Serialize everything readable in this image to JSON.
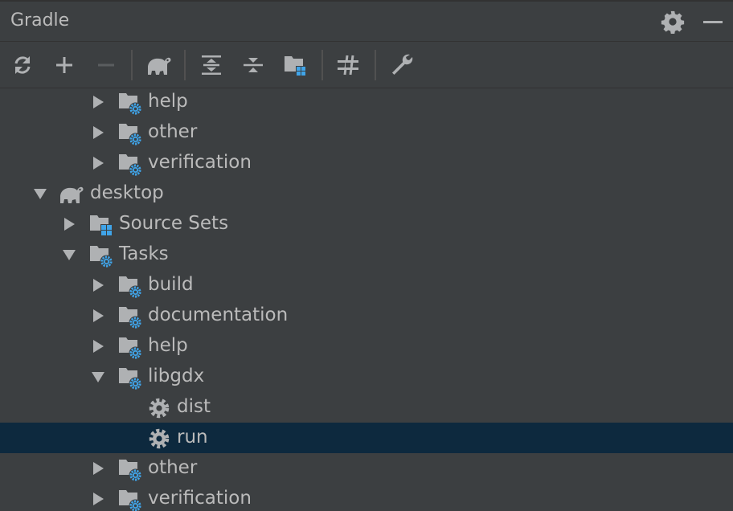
{
  "panel": {
    "title": "Gradle",
    "title_actions": [
      {
        "name": "settings-gear-icon"
      },
      {
        "name": "minimize-icon"
      }
    ]
  },
  "toolbar": {
    "items": [
      {
        "name": "refresh-icon",
        "tooltip": ""
      },
      {
        "name": "add-icon"
      },
      {
        "name": "remove-icon",
        "disabled": true
      },
      {
        "name": "gradle-elephant-icon"
      },
      {
        "name": "expand-all-icon"
      },
      {
        "name": "collapse-all-icon"
      },
      {
        "name": "source-sets-folder-icon"
      },
      {
        "name": "toggle-offline-icon"
      },
      {
        "name": "wrench-icon"
      }
    ]
  },
  "tree": {
    "rows": [
      {
        "label": "help",
        "kind": "task-folder",
        "expanded": false
      },
      {
        "label": "other",
        "kind": "task-folder",
        "expanded": false
      },
      {
        "label": "verification",
        "kind": "task-folder",
        "expanded": false
      },
      {
        "label": "desktop",
        "kind": "gradle-project",
        "expanded": true
      },
      {
        "label": "Source Sets",
        "kind": "source-sets-folder",
        "expanded": false
      },
      {
        "label": "Tasks",
        "kind": "task-folder",
        "expanded": true
      },
      {
        "label": "build",
        "kind": "task-folder",
        "expanded": false
      },
      {
        "label": "documentation",
        "kind": "task-folder",
        "expanded": false
      },
      {
        "label": "help",
        "kind": "task-folder",
        "expanded": false
      },
      {
        "label": "libgdx",
        "kind": "task-folder",
        "expanded": true
      },
      {
        "label": "dist",
        "kind": "task",
        "expanded": null
      },
      {
        "label": "run",
        "kind": "task",
        "expanded": null,
        "selected": true
      },
      {
        "label": "other",
        "kind": "task-folder",
        "expanded": false
      },
      {
        "label": "verification",
        "kind": "task-folder",
        "expanded": false
      }
    ]
  },
  "colors": {
    "background": "#3c3f41",
    "text": "#bbbbbb",
    "selection": "#0d293e",
    "icon_gray": "#afb1b3",
    "accent_blue": "#40a4e8"
  }
}
